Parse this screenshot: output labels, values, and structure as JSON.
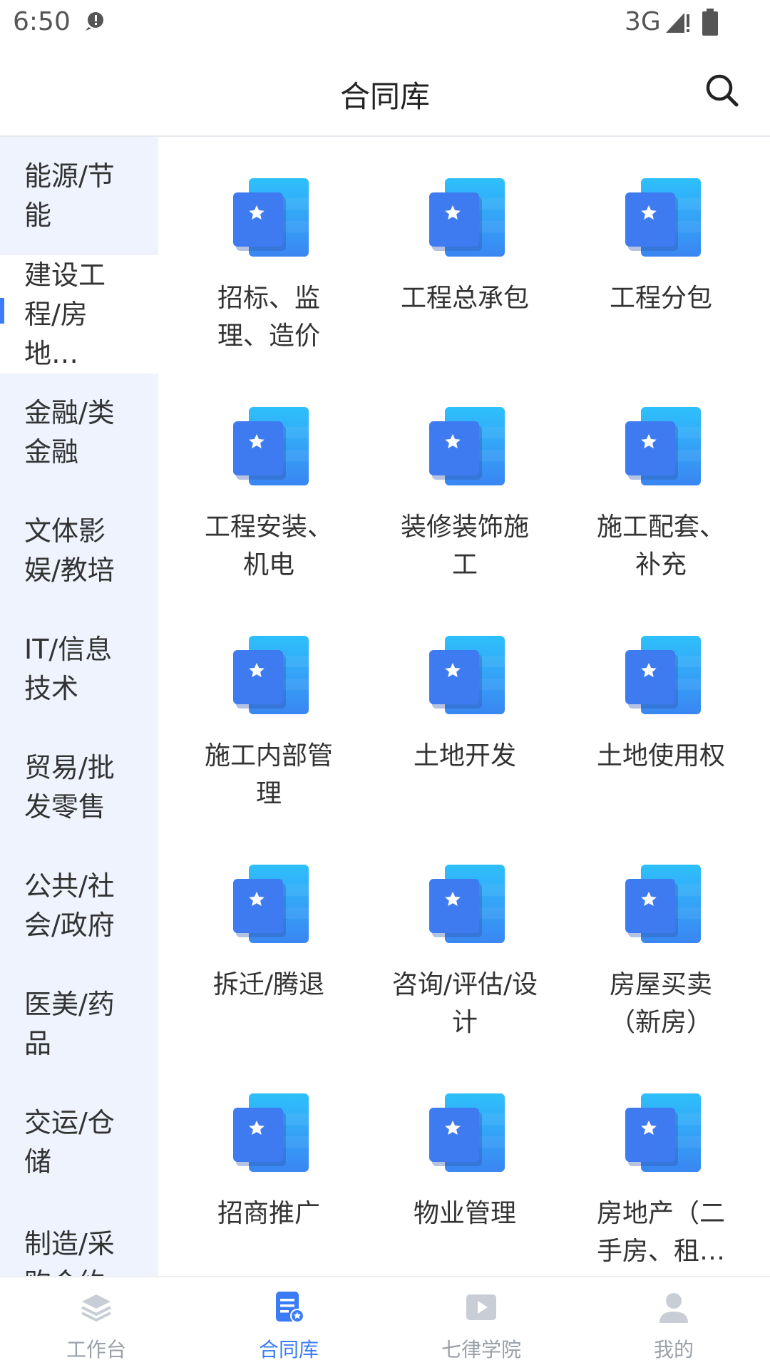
{
  "status_bar": {
    "time": "6:50",
    "network": "3G"
  },
  "header": {
    "title": "合同库",
    "search_icon": "search-icon"
  },
  "sidebar": {
    "items": [
      {
        "label": "能源/节能",
        "active": false
      },
      {
        "label": "建设工程/房地…",
        "active": true
      },
      {
        "label": "金融/类金融",
        "active": false
      },
      {
        "label": "文体影娱/教培",
        "active": false
      },
      {
        "label": "IT/信息技术",
        "active": false
      },
      {
        "label": "贸易/批发零售",
        "active": false
      },
      {
        "label": "公共/社会/政府",
        "active": false
      },
      {
        "label": "医美/药品",
        "active": false
      },
      {
        "label": "交运/仓储",
        "active": false
      },
      {
        "label": "制造/采购合约",
        "active": false
      }
    ]
  },
  "grid": {
    "items": [
      {
        "label": "招标、监理、造价"
      },
      {
        "label": "工程总承包"
      },
      {
        "label": "工程分包"
      },
      {
        "label": "工程安装、机电"
      },
      {
        "label": "装修装饰施工"
      },
      {
        "label": "施工配套、补充"
      },
      {
        "label": "施工内部管理"
      },
      {
        "label": "土地开发"
      },
      {
        "label": "土地使用权"
      },
      {
        "label": "拆迁/腾退"
      },
      {
        "label": "咨询/评估/设计"
      },
      {
        "label": "房屋买卖（新房）"
      },
      {
        "label": "招商推广"
      },
      {
        "label": "物业管理"
      },
      {
        "label": "房地产（二手房、租…"
      }
    ]
  },
  "bottom_nav": {
    "items": [
      {
        "label": "工作台",
        "icon": "layers-icon",
        "active": false
      },
      {
        "label": "合同库",
        "icon": "contract-doc-icon",
        "active": true
      },
      {
        "label": "七律学院",
        "icon": "video-play-icon",
        "active": false
      },
      {
        "label": "我的",
        "icon": "user-icon",
        "active": false
      }
    ]
  },
  "colors": {
    "accent": "#3b7cf6",
    "sidebar_bg": "#eef3fd",
    "icon_light": "#29b6f6",
    "icon_dark": "#3d7cf0"
  }
}
